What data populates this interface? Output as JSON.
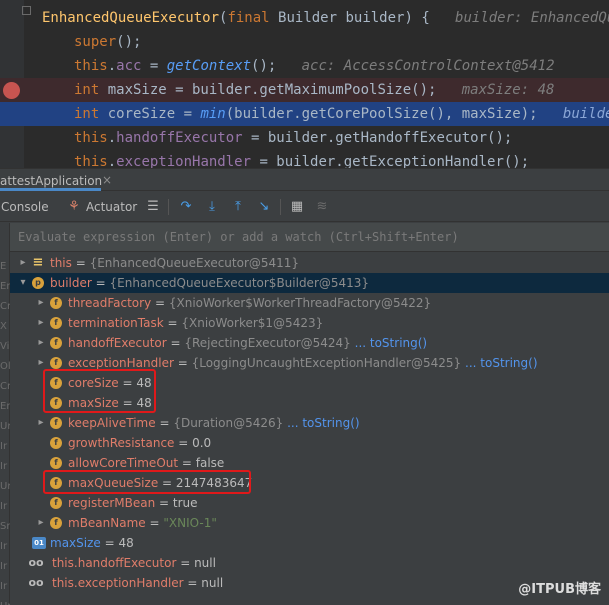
{
  "editor": {
    "lines": [
      {
        "parts": [
          {
            "t": "EnhancedQueueExecutor",
            "c": "fn"
          },
          {
            "t": "(",
            "c": ""
          },
          {
            "t": "final ",
            "c": "kw"
          },
          {
            "t": "Builder builder) {",
            "c": ""
          },
          {
            "t": "   builder: EnhancedQueueExecutor$Bu",
            "c": "hint"
          }
        ]
      },
      {
        "parts": [
          {
            "t": "super",
            "c": "kw"
          },
          {
            "t": "();",
            "c": ""
          }
        ]
      },
      {
        "parts": [
          {
            "t": "this",
            "c": "kw"
          },
          {
            "t": ".",
            "c": ""
          },
          {
            "t": "acc",
            "c": "fld"
          },
          {
            "t": " = ",
            "c": ""
          },
          {
            "t": "getContext",
            "c": "mc"
          },
          {
            "t": "();",
            "c": ""
          },
          {
            "t": "   acc: AccessControlContext@5412",
            "c": "hint"
          }
        ]
      },
      {
        "parts": [
          {
            "t": "int ",
            "c": "kw"
          },
          {
            "t": "maxSize = builder.getMaximumPoolSize();",
            "c": ""
          },
          {
            "t": "   maxSize: 48",
            "c": "hint"
          }
        ]
      },
      {
        "parts": [
          {
            "t": "int ",
            "c": "kw"
          },
          {
            "t": "coreSize = ",
            "c": ""
          },
          {
            "t": "min",
            "c": "mc"
          },
          {
            "t": "(builder.getCorePoolSize(), maxSize);",
            "c": ""
          },
          {
            "t": "   builder: Enhanc",
            "c": "hint-sel"
          }
        ]
      },
      {
        "parts": [
          {
            "t": "this",
            "c": "kw"
          },
          {
            "t": ".",
            "c": ""
          },
          {
            "t": "handoffExecutor",
            "c": "fld"
          },
          {
            "t": " = builder.getHandoffExecutor();",
            "c": ""
          }
        ]
      },
      {
        "parts": [
          {
            "t": "this",
            "c": "kw"
          },
          {
            "t": ".",
            "c": ""
          },
          {
            "t": "exceptionHandler",
            "c": "fld"
          },
          {
            "t": " = builder.getExceptionHandler();",
            "c": ""
          }
        ]
      }
    ]
  },
  "debug": {
    "tab_title": "attestApplication",
    "close_glyph": "×",
    "toolbar": {
      "console_label": "Console",
      "actuator_label": "Actuator"
    },
    "evaluate_placeholder": "Evaluate expression (Enter) or add a watch (Ctrl+Shift+Enter)",
    "left_strip_letters": [
      "E",
      "Er",
      "Cr",
      "X",
      "Vi",
      "Ol",
      "Cr",
      "Er",
      "Ur",
      "Ir",
      "Ir",
      "Ur",
      "Ir",
      "Sr",
      "Ir",
      "Ir",
      "Ir",
      "Ur"
    ],
    "variables": [
      {
        "name": "this",
        "sep": " = ",
        "value": "{EnhancedQueueExecutor@5411}",
        "link": "",
        "icon": "eq",
        "icon_glyph": "≡",
        "expand": "▸"
      },
      {
        "name": "builder",
        "sep": " = ",
        "value": "{EnhancedQueueExecutor$Builder@5413}",
        "link": "",
        "icon": "p",
        "icon_glyph": "p",
        "expand": "▾"
      },
      {
        "name": "threadFactory",
        "sep": " = ",
        "value": "{XnioWorker$WorkerThreadFactory@5422}",
        "link": "",
        "icon": "f",
        "icon_glyph": "f",
        "expand": "▸"
      },
      {
        "name": "terminationTask",
        "sep": " = ",
        "value": "{XnioWorker$1@5423}",
        "link": "",
        "icon": "f",
        "icon_glyph": "f",
        "expand": "▸"
      },
      {
        "name": "handoffExecutor",
        "sep": " = ",
        "value": "{RejectingExecutor@5424}",
        "link": " ... toString()",
        "icon": "f",
        "icon_glyph": "f",
        "expand": "▸"
      },
      {
        "name": "exceptionHandler",
        "sep": " = ",
        "value": "{LoggingUncaughtExceptionHandler@5425}",
        "link": " ... toString()",
        "icon": "f",
        "icon_glyph": "f",
        "expand": "▸"
      },
      {
        "name": "coreSize",
        "sep": " = ",
        "value": "48",
        "link": "",
        "icon": "f",
        "icon_glyph": "f",
        "expand": ""
      },
      {
        "name": "maxSize",
        "sep": " = ",
        "value": "48",
        "link": "",
        "icon": "f",
        "icon_glyph": "f",
        "expand": ""
      },
      {
        "name": "keepAliveTime",
        "sep": " = ",
        "value": "{Duration@5426}",
        "link": " ... toString()",
        "icon": "f",
        "icon_glyph": "f",
        "expand": "▸"
      },
      {
        "name": "growthResistance",
        "sep": " = ",
        "value": "0.0",
        "link": "",
        "icon": "f",
        "icon_glyph": "f",
        "expand": ""
      },
      {
        "name": "allowCoreTimeOut",
        "sep": " = ",
        "value": "false",
        "link": "",
        "icon": "f",
        "icon_glyph": "f",
        "expand": ""
      },
      {
        "name": "maxQueueSize",
        "sep": " = ",
        "value": "2147483647",
        "link": "",
        "icon": "f",
        "icon_glyph": "f",
        "expand": ""
      },
      {
        "name": "registerMBean",
        "sep": " = ",
        "value": "true",
        "link": "",
        "icon": "f",
        "icon_glyph": "f",
        "expand": ""
      },
      {
        "name": "mBeanName",
        "sep": " = ",
        "value": "\"XNIO-1\"",
        "link": "",
        "icon": "f",
        "icon_glyph": "f",
        "expand": "▸"
      },
      {
        "name": "maxSize",
        "sep": " = ",
        "value": "48",
        "link": "",
        "icon": "oi",
        "icon_glyph": "01",
        "expand": ""
      },
      {
        "name": "this.handoffExecutor",
        "sep": " = ",
        "value": "null",
        "link": "",
        "icon": "glass",
        "icon_glyph": "oo",
        "expand": ""
      },
      {
        "name": "this.exceptionHandler",
        "sep": " = ",
        "value": "null",
        "link": "",
        "icon": "glass",
        "icon_glyph": "oo",
        "expand": ""
      }
    ]
  },
  "watermark": "@ITPUB博客",
  "colors": {
    "editor_bg": "#2b2b2b",
    "keyword": "#cc7832",
    "field": "#9876aa",
    "method_def": "#ffc66d",
    "execution_line": "#214283",
    "highlight_box": "#e0191a",
    "field_name": "#e07d6a",
    "link": "#5394ec"
  }
}
